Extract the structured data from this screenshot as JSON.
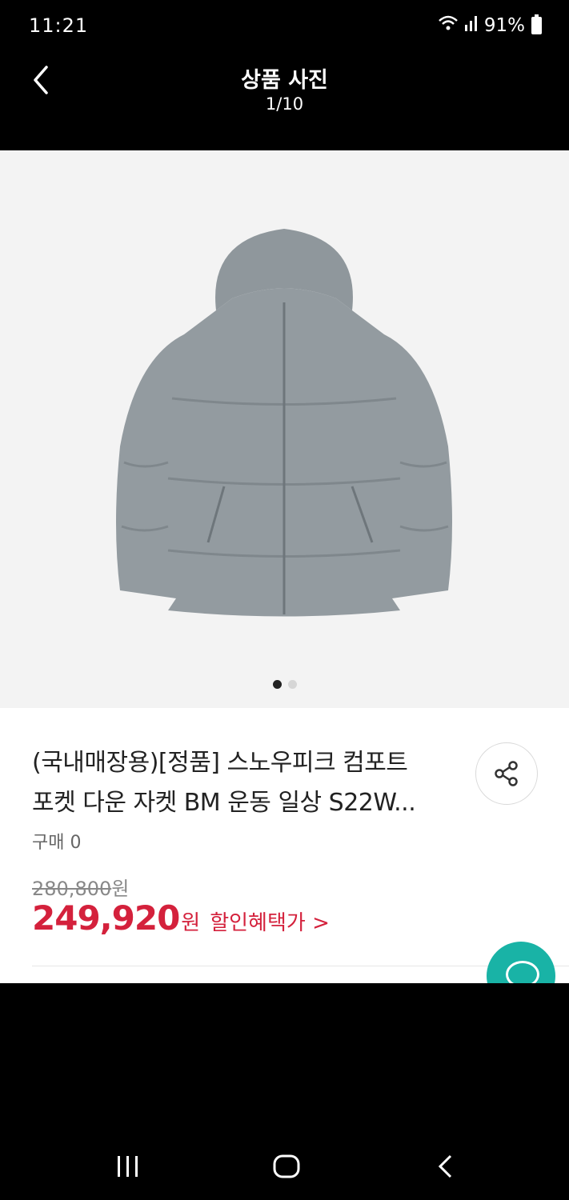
{
  "status_bar": {
    "time": "11:21",
    "battery": "91%"
  },
  "header": {
    "title": "상품 사진",
    "counter": "1/10"
  },
  "gallery": {
    "total_dots": 2,
    "active_dot": 1
  },
  "product": {
    "name_line1": "(국내매장용)[정품] 스노우피크 컴포트",
    "name_line2": "포켓 다운 자켓 BM 운동 일상 S22W...",
    "purchase_label": "구매 0",
    "original_price": "280,800",
    "original_unit": "원",
    "sale_price": "249,920",
    "sale_unit": "원",
    "benefit_label": "할인혜택가 >"
  },
  "colors": {
    "accent_red": "#d4213c",
    "fab_teal": "#19b3a6"
  }
}
